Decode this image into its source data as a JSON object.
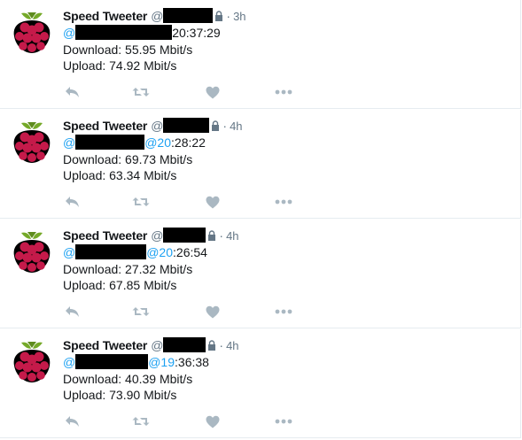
{
  "tweets": [
    {
      "name": "Speed Tweeter",
      "at": "@",
      "time": "3h",
      "dot": "·",
      "mention_prefix": "@",
      "mention_suffix": "",
      "time_text": "20:37:29",
      "download": "Download: 55.95 Mbit/s",
      "upload": "Upload: 74.92 Mbit/s"
    },
    {
      "name": "Speed Tweeter",
      "at": "@",
      "time": "4h",
      "dot": "·",
      "mention_prefix": "@",
      "mention_suffix": "@20",
      "time_text": ":28:22",
      "download": "Download: 69.73 Mbit/s",
      "upload": "Upload: 63.34 Mbit/s"
    },
    {
      "name": "Speed Tweeter",
      "at": "@",
      "time": "4h",
      "dot": "·",
      "mention_prefix": "@",
      "mention_suffix": "@20",
      "time_text": ":26:54",
      "download": "Download: 27.32 Mbit/s",
      "upload": "Upload: 67.85 Mbit/s"
    },
    {
      "name": "Speed Tweeter",
      "at": "@",
      "time": "4h",
      "dot": "·",
      "mention_prefix": "@",
      "mention_suffix": "@19",
      "time_text": ":36:38",
      "download": "Download: 40.39 Mbit/s",
      "upload": "Upload: 73.90 Mbit/s"
    }
  ],
  "icons": {
    "avatar": "raspberry-pi-logo",
    "protected": "lock-icon",
    "reply": "reply-icon",
    "retweet": "retweet-icon",
    "like": "heart-icon",
    "more": "more-icon"
  },
  "colors": {
    "link": "#1da1f2",
    "meta": "#657786",
    "icon": "#aab8c2",
    "raspberry": "#c51a4a",
    "leaf": "#75a928"
  }
}
